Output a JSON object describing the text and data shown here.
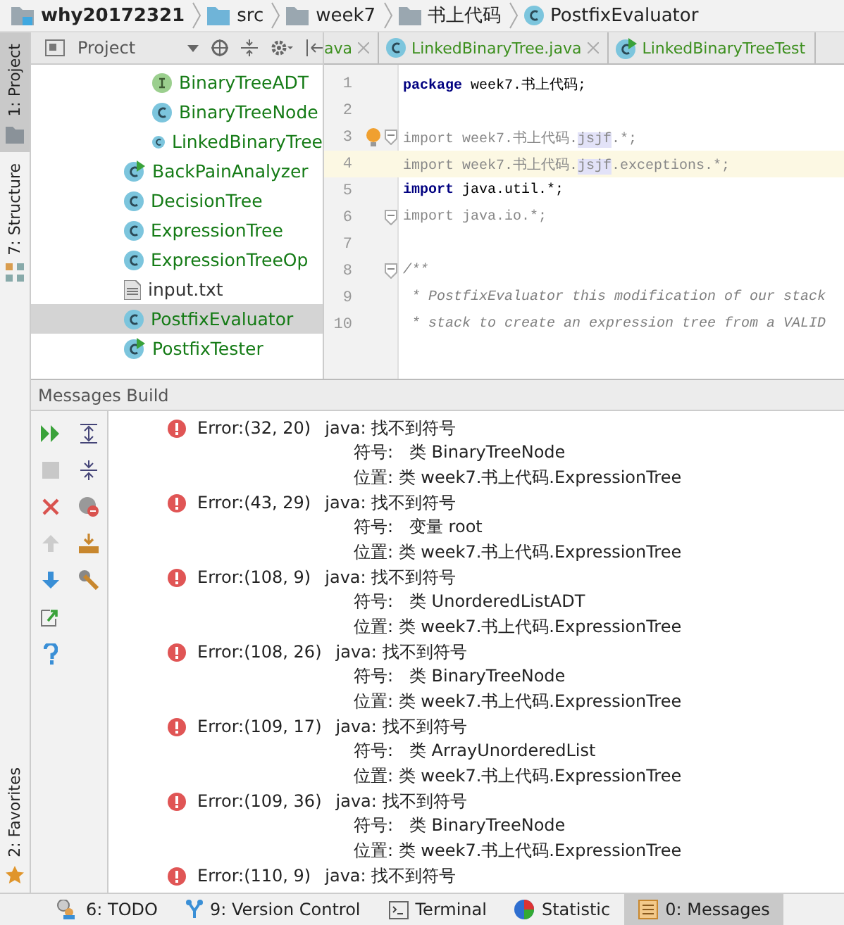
{
  "breadcrumbs": [
    {
      "label": "why20172321",
      "kind": "project"
    },
    {
      "label": "src",
      "kind": "folder"
    },
    {
      "label": "week7",
      "kind": "folder"
    },
    {
      "label": "书上代码",
      "kind": "folder"
    },
    {
      "label": "PostfixEvaluator",
      "kind": "class"
    }
  ],
  "side_tabs": [
    {
      "label": "1: Project",
      "selected": true,
      "kind": "project"
    },
    {
      "label": "7: Structure",
      "selected": false,
      "kind": "structure"
    }
  ],
  "side_tabs_bottom": [
    {
      "label": "2: Favorites",
      "selected": false,
      "kind": "favorites"
    }
  ],
  "project_panel": {
    "title": "Project"
  },
  "tree": [
    {
      "children": [
        {
          "label": "BinaryTreeADT",
          "kind": "interface",
          "selected": false
        },
        {
          "label": "BinaryTreeNode",
          "kind": "class",
          "selected": false
        },
        {
          "label": "LinkedBinaryTree",
          "kind": "class",
          "selected": false
        }
      ]
    },
    {
      "label": "BackPainAnalyzer",
      "kind": "runnable",
      "selected": false
    },
    {
      "label": "DecisionTree",
      "kind": "class",
      "selected": false
    },
    {
      "label": "ExpressionTree",
      "kind": "class",
      "selected": false
    },
    {
      "label": "ExpressionTreeOp",
      "kind": "class",
      "selected": false
    },
    {
      "label": "input.txt",
      "kind": "file",
      "selected": false
    },
    {
      "label": "PostfixEvaluator",
      "kind": "class",
      "selected": true
    },
    {
      "label": "PostfixTester",
      "kind": "runnable",
      "selected": false
    }
  ],
  "editor_tabs": [
    {
      "label": "ava",
      "kind": "none",
      "selected": false
    },
    {
      "label": "LinkedBinaryTree.java",
      "kind": "class",
      "selected": false
    },
    {
      "label": "LinkedBinaryTreeTest",
      "kind": "runnable",
      "selected": false
    }
  ],
  "code_lines": [
    {
      "number": "1",
      "current": false,
      "fold": false,
      "bulb": false,
      "tokens": [
        {
          "text": "package",
          "kind": "keyword"
        },
        {
          "text": " week7.书上代码;",
          "kind": "plain"
        }
      ]
    },
    {
      "number": "2",
      "current": false,
      "fold": false,
      "bulb": false
    },
    {
      "number": "3",
      "current": false,
      "fold": true,
      "bulb": true,
      "tokens": [
        {
          "text": "import",
          "kind": "unused"
        },
        {
          "text": " week7.书上代码.",
          "kind": "unused"
        },
        {
          "text": "jsjf",
          "kind": "highlight"
        },
        {
          "text": ".*;",
          "kind": "unused"
        }
      ]
    },
    {
      "number": "4",
      "current": true,
      "fold": false,
      "bulb": false,
      "tokens": [
        {
          "text": "import",
          "kind": "unused"
        },
        {
          "text": " week7.书上代码.",
          "kind": "unused"
        },
        {
          "text": "jsjf",
          "kind": "highlight"
        },
        {
          "text": ".exceptions.*;",
          "kind": "unused"
        }
      ]
    },
    {
      "number": "5",
      "current": false,
      "fold": false,
      "bulb": false,
      "tokens": [
        {
          "text": "import",
          "kind": "keyword"
        },
        {
          "text": " java.util.*;",
          "kind": "plain"
        }
      ]
    },
    {
      "number": "6",
      "current": false,
      "fold": true,
      "bulb": false,
      "tokens": [
        {
          "text": "import",
          "kind": "unused"
        },
        {
          "text": " java.io.*;",
          "kind": "unused"
        }
      ]
    },
    {
      "number": "7",
      "current": false,
      "fold": false,
      "bulb": false
    },
    {
      "number": "8",
      "current": false,
      "fold": true,
      "bulb": false,
      "tokens": [
        {
          "text": "/**",
          "kind": "comment"
        }
      ]
    },
    {
      "number": "9",
      "current": false,
      "fold": false,
      "bulb": false,
      "tokens": [
        {
          "text": " * PostfixEvaluator this modification of our stack",
          "kind": "comment"
        }
      ]
    },
    {
      "number": "10",
      "current": false,
      "fold": false,
      "bulb": false,
      "tokens": [
        {
          "text": " * stack to create an expression tree from a VALID",
          "kind": "comment"
        }
      ]
    }
  ],
  "messages_panel": {
    "title": "Messages Build"
  },
  "messages": [
    {
      "position": "Error:(32, 20)",
      "text": "java: 找不到符号",
      "details": [
        "符号:   类 BinaryTreeNode",
        "位置: 类 week7.书上代码.ExpressionTree"
      ]
    },
    {
      "position": "Error:(43, 29)",
      "text": "java: 找不到符号",
      "details": [
        "符号:   变量 root",
        "位置: 类 week7.书上代码.ExpressionTree"
      ]
    },
    {
      "position": "Error:(108, 9)",
      "text": "java: 找不到符号",
      "details": [
        "符号:   类 UnorderedListADT",
        "位置: 类 week7.书上代码.ExpressionTree"
      ]
    },
    {
      "position": "Error:(108, 26)",
      "text": "java: 找不到符号",
      "details": [
        "符号:   类 BinaryTreeNode",
        "位置: 类 week7.书上代码.ExpressionTree"
      ]
    },
    {
      "position": "Error:(109, 17)",
      "text": "java: 找不到符号",
      "details": [
        "符号:   类 ArrayUnorderedList",
        "位置: 类 week7.书上代码.ExpressionTree"
      ]
    },
    {
      "position": "Error:(109, 36)",
      "text": "java: 找不到符号",
      "details": [
        "符号:   类 BinaryTreeNode",
        "位置: 类 week7.书上代码.ExpressionTree"
      ]
    },
    {
      "position": "Error:(110, 9)",
      "text": "java: 找不到符号"
    }
  ],
  "bottom_tabs": [
    {
      "label": "6: TODO",
      "kind": "todo",
      "selected": false
    },
    {
      "label": "9: Version Control",
      "kind": "vcs",
      "selected": false
    },
    {
      "label": "Terminal",
      "kind": "terminal",
      "selected": false
    },
    {
      "label": "Statistic",
      "kind": "statistic",
      "selected": false
    },
    {
      "label": "0: Messages",
      "kind": "messages",
      "selected": true
    }
  ]
}
